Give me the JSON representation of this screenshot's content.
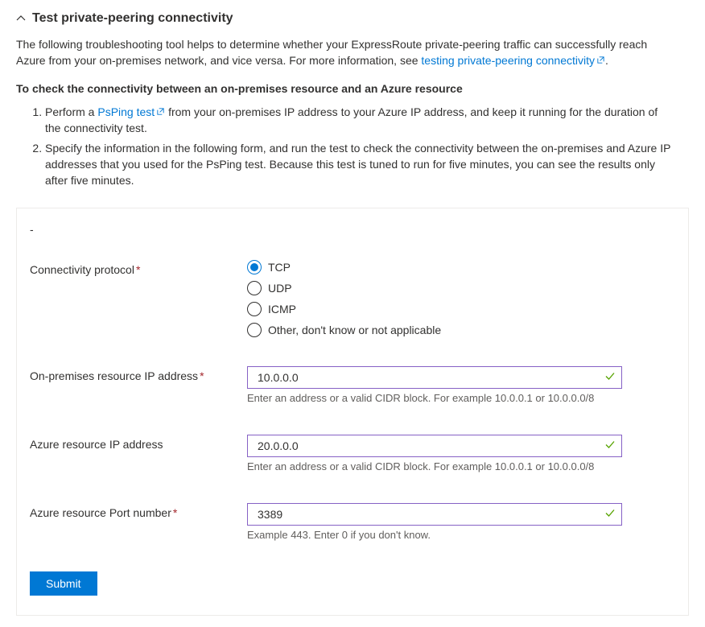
{
  "header": {
    "title": "Test private-peering connectivity"
  },
  "intro": {
    "text_before": "The following troubleshooting tool helps to determine whether your ExpressRoute private-peering traffic can successfully reach Azure from your on-premises network, and vice versa. For more information, see ",
    "link_text": "testing private-peering connectivity",
    "text_after": "."
  },
  "subheading": "To check the connectivity between an on-premises resource and an Azure resource",
  "steps": {
    "step1_before": "Perform a ",
    "step1_link": "PsPing test",
    "step1_after": " from your on-premises IP address to your Azure IP address, and keep it running for the duration of the connectivity test.",
    "step2": "Specify the information in the following form, and run the test to check the connectivity between the on-premises and Azure IP addresses that you used for the PsPing test. Because this test is tuned to run for five minutes, you can see the results only after five minutes."
  },
  "form": {
    "protocol": {
      "label": "Connectivity protocol",
      "required": "*",
      "options": {
        "tcp": "TCP",
        "udp": "UDP",
        "icmp": "ICMP",
        "other": "Other, don't know or not applicable"
      },
      "selected": "tcp"
    },
    "onprem_ip": {
      "label": "On-premises resource IP address",
      "required": "*",
      "value": "10.0.0.0",
      "help": "Enter an address or a valid CIDR block. For example 10.0.0.1 or 10.0.0.0/8"
    },
    "azure_ip": {
      "label": "Azure resource IP address",
      "required": "",
      "value": "20.0.0.0",
      "help": "Enter an address or a valid CIDR block. For example 10.0.0.1 or 10.0.0.0/8"
    },
    "azure_port": {
      "label": "Azure resource Port number",
      "required": "*",
      "value": "3389",
      "help": "Example 443. Enter 0 if you don't know."
    },
    "submit_label": "Submit"
  }
}
